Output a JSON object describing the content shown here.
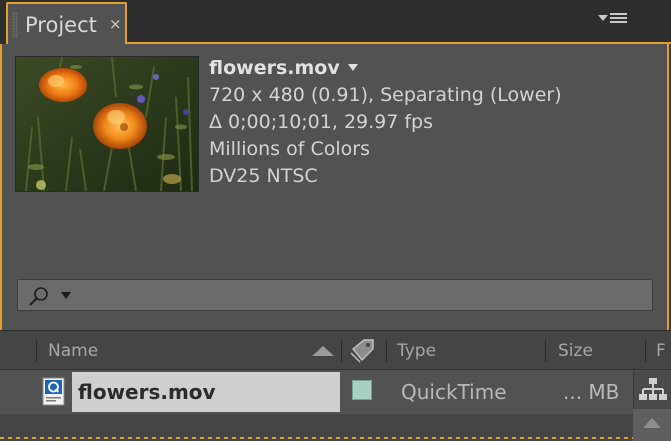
{
  "panel": {
    "tab_label": "Project",
    "close_glyph": "×",
    "menu_icon": "panel-menu-icon",
    "accent_color": "#e3a026"
  },
  "preview": {
    "filename": "flowers.mov",
    "details": [
      "720 x 480 (0.91), Separating (Lower)",
      "Δ 0;00;10;01, 29.97 fps",
      "Millions of Colors",
      "DV25 NTSC"
    ]
  },
  "search": {
    "value": "",
    "placeholder": ""
  },
  "columns": {
    "name": "Name",
    "type": "Type",
    "size": "Size",
    "partial": "F"
  },
  "items": [
    {
      "name": "flowers.mov",
      "type": "QuickTime",
      "size": "... MB",
      "label_color": "#a7cfc2"
    }
  ]
}
